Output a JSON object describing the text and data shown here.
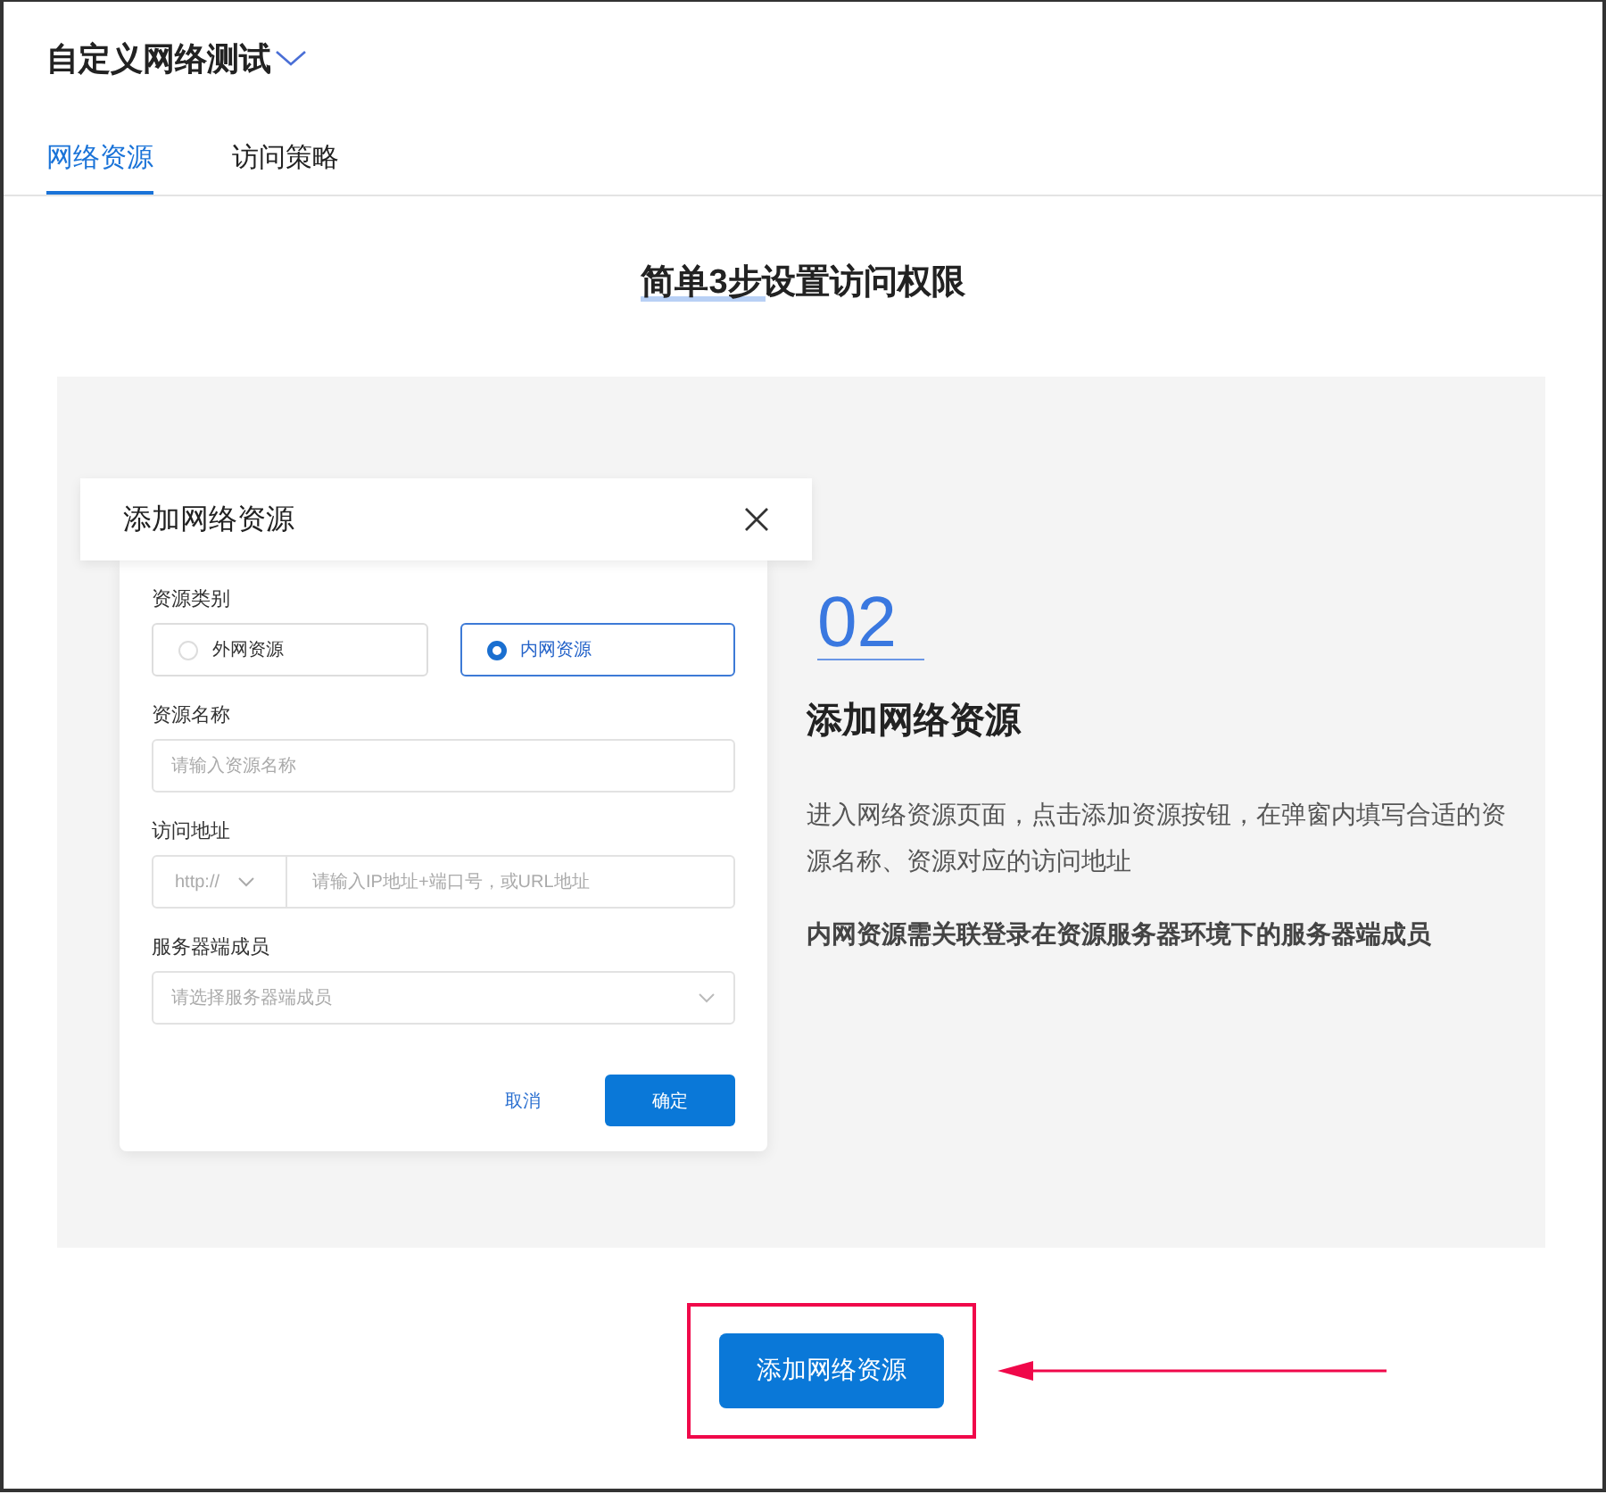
{
  "header": {
    "title": "自定义网络测试"
  },
  "tabs": [
    {
      "label": "网络资源",
      "selected": true
    },
    {
      "label": "访问策略",
      "selected": false
    }
  ],
  "heading": "简单3步设置访问权限",
  "illustration": {
    "dialog": {
      "title": "添加网络资源",
      "fields": [
        {
          "kind": "radio",
          "label": "资源类别",
          "options": [
            {
              "label": "外网资源",
              "selected": false
            },
            {
              "label": "内网资源",
              "selected": true
            }
          ]
        },
        {
          "kind": "input",
          "label": "资源名称",
          "placeholder": "请输入资源名称"
        },
        {
          "kind": "url",
          "label": "访问地址",
          "prefix": "http://",
          "placeholder": "请输入IP地址+端口号，或URL地址"
        },
        {
          "kind": "select",
          "label": "服务器端成员",
          "placeholder": "请选择服务器端成员"
        }
      ],
      "buttons": [
        {
          "kind": "text",
          "label": "取消"
        },
        {
          "kind": "primary",
          "label": "确定"
        }
      ]
    },
    "step": {
      "number": "02",
      "title": "添加网络资源",
      "description": "进入网络资源页面，点击添加资源按钮，在弹窗内填写合适的资源名称、资源对应的访问地址",
      "note": "内网资源需关联登录在资源服务器环境下的服务器端成员"
    }
  },
  "action_button": "添加网络资源"
}
